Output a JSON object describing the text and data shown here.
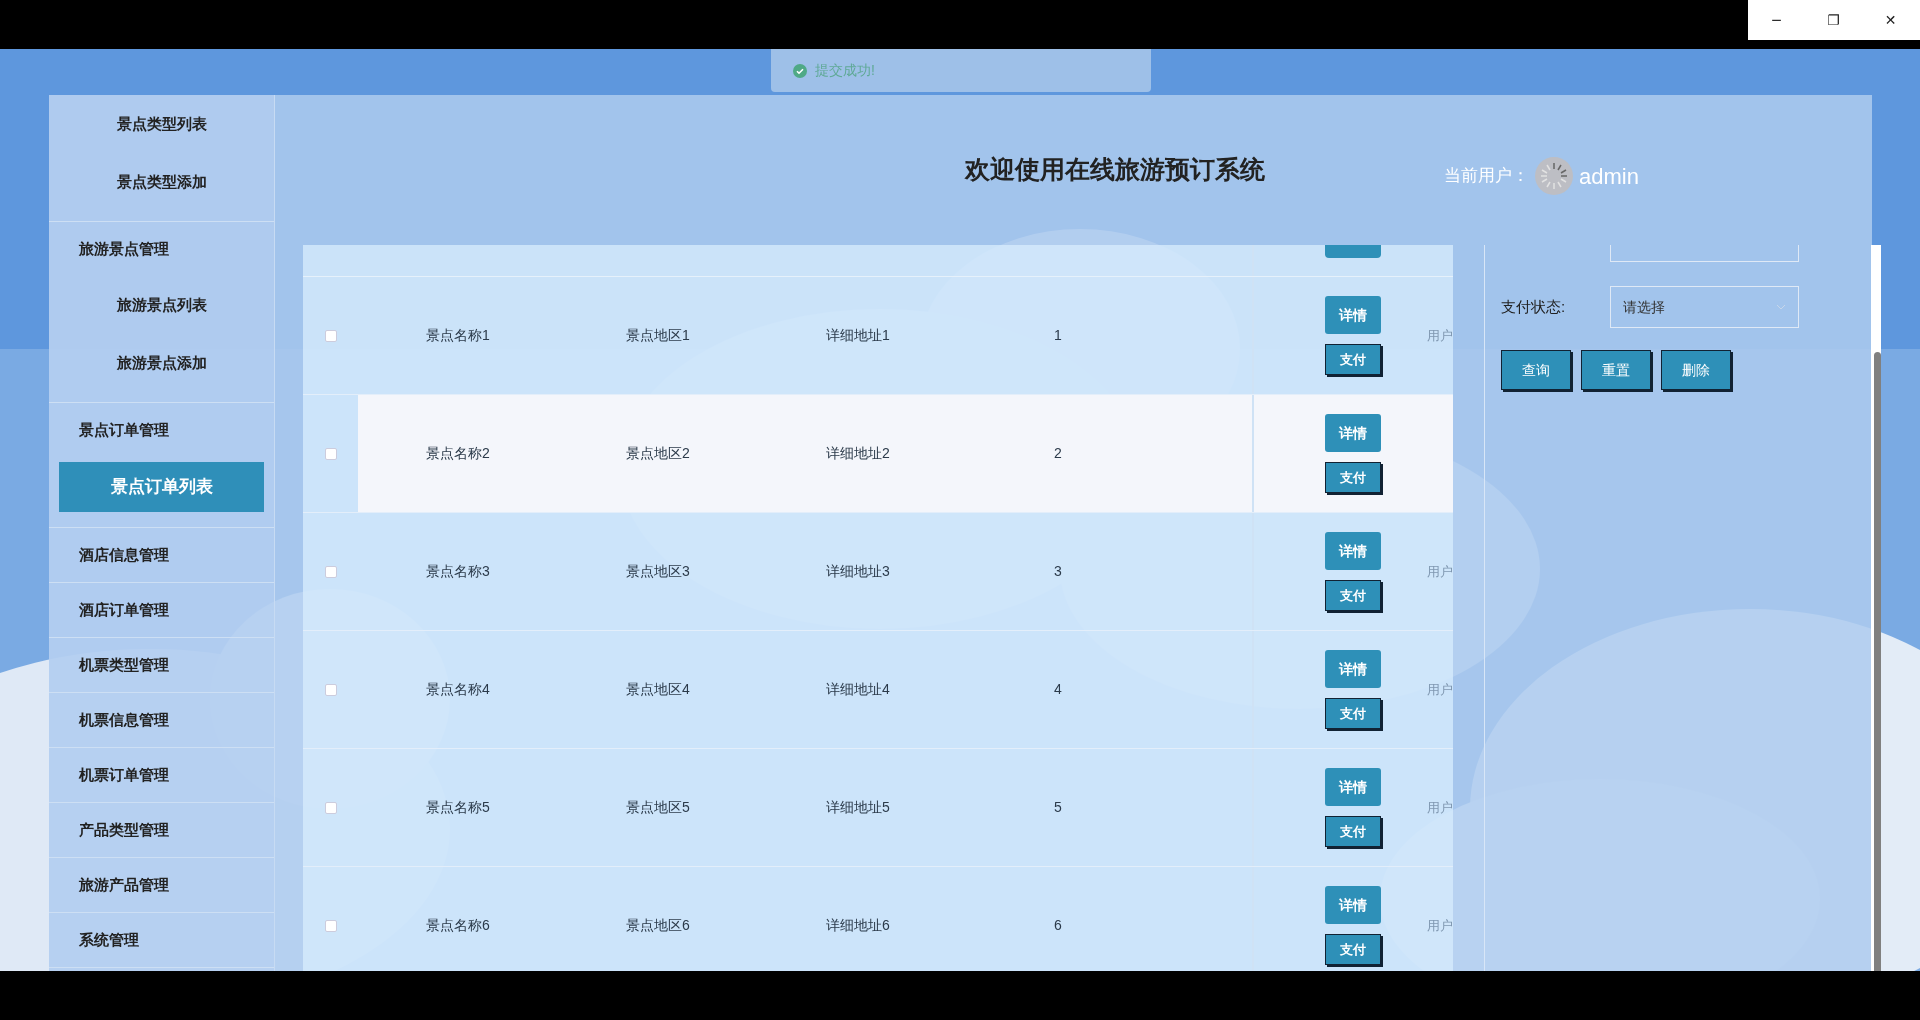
{
  "window_controls": {
    "minimize": "─",
    "maximize": "❐",
    "close": "✕"
  },
  "toast": {
    "message": "提交成功!"
  },
  "sidebar": {
    "groups": [
      {
        "children": [
          {
            "label": "景点类型列表",
            "selected": false
          },
          {
            "label": "景点类型添加",
            "selected": false
          }
        ]
      },
      {
        "label": "旅游景点管理",
        "children": [
          {
            "label": "旅游景点列表",
            "selected": false
          },
          {
            "label": "旅游景点添加",
            "selected": false
          }
        ]
      },
      {
        "label": "景点订单管理",
        "children": [
          {
            "label": "景点订单列表",
            "selected": true
          }
        ]
      },
      {
        "label": "酒店信息管理"
      },
      {
        "label": "酒店订单管理"
      },
      {
        "label": "机票类型管理"
      },
      {
        "label": "机票信息管理"
      },
      {
        "label": "机票订单管理"
      },
      {
        "label": "产品类型管理"
      },
      {
        "label": "旅游产品管理"
      },
      {
        "label": "系统管理"
      }
    ]
  },
  "header": {
    "title": "欢迎使用在线旅游预订系统",
    "user_label": "当前用户：",
    "username": "admin"
  },
  "table": {
    "rows": [
      {
        "checked": false,
        "highlighted": false,
        "name": "景点名称1",
        "region": "景点地区1",
        "address": "详细地址1",
        "number": "1",
        "detail_button": "详情",
        "pay_button": "支付",
        "column_6": "用户"
      },
      {
        "checked": false,
        "highlighted": true,
        "name": "景点名称2",
        "region": "景点地区2",
        "address": "详细地址2",
        "number": "2",
        "detail_button": "详情",
        "pay_button": "支付"
      },
      {
        "checked": false,
        "highlighted": false,
        "name": "景点名称3",
        "region": "景点地区3",
        "address": "详细地址3",
        "number": "3",
        "detail_button": "详情",
        "pay_button": "支付",
        "column_6": "用户"
      },
      {
        "checked": false,
        "highlighted": false,
        "name": "景点名称4",
        "region": "景点地区4",
        "address": "详细地址4",
        "number": "4",
        "detail_button": "详情",
        "pay_button": "支付",
        "column_6": "用户"
      },
      {
        "checked": false,
        "highlighted": false,
        "name": "景点名称5",
        "region": "景点地区5",
        "address": "详细地址5",
        "number": "5",
        "detail_button": "详情",
        "pay_button": "支付",
        "column_6": "用户"
      },
      {
        "checked": false,
        "highlighted": false,
        "name": "景点名称6",
        "region": "景点地区6",
        "address": "详细地址6",
        "number": "6",
        "detail_button": "详情",
        "pay_button": "支付",
        "column_6": "用户"
      }
    ]
  },
  "filter": {
    "payment_status_label": "支付状态:",
    "payment_status_placeholder": "请选择",
    "buttons": [
      "查询",
      "重置",
      "删除"
    ]
  }
}
